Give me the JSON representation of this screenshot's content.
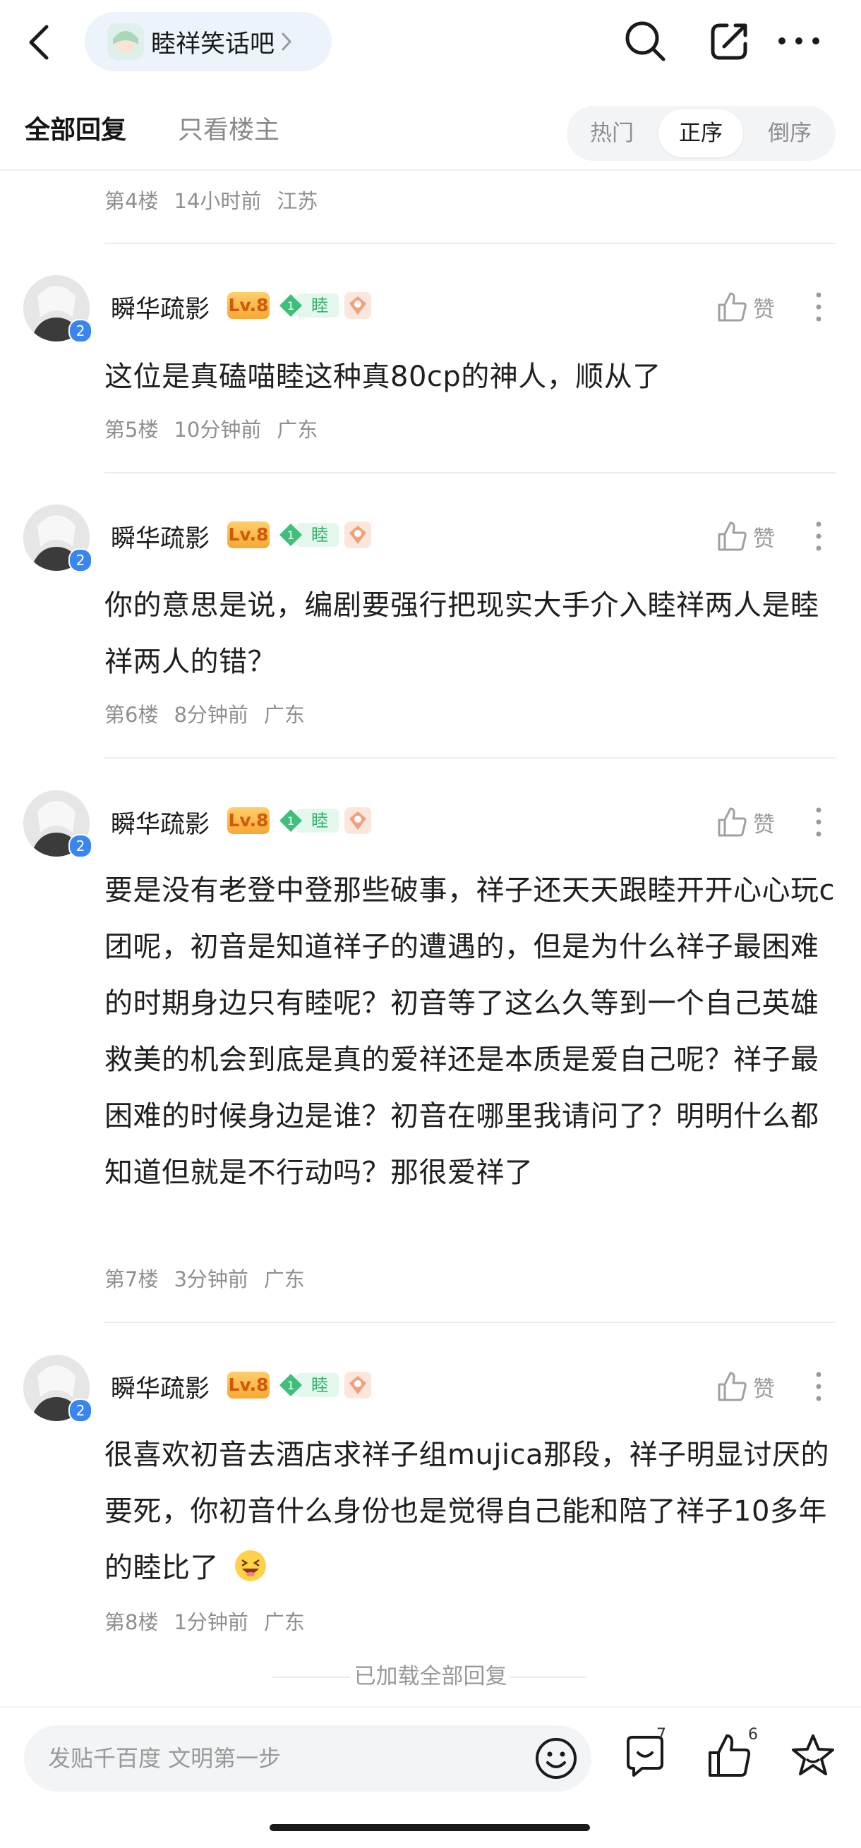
{
  "top_bar": {
    "forum_name": "睦祥笑话吧"
  },
  "tabs": {
    "all_replies": "全部回复",
    "only_op": "只看楼主",
    "sort": [
      "热门",
      "正序",
      "倒序"
    ],
    "active_sort": "正序"
  },
  "prev_post_meta": {
    "floor": "第4楼",
    "time": "14小时前",
    "location": "江苏"
  },
  "user": {
    "name": "瞬华疏影",
    "level": "Lv.8",
    "fan_level": "1",
    "fan_label": "睦",
    "avatar_badge": "2"
  },
  "like_label": "赞",
  "posts": [
    {
      "text": "这位是真磕喵睦这种真80cp的神人，顺从了",
      "floor": "第5楼",
      "time": "10分钟前",
      "location": "广东"
    },
    {
      "text": "你的意思是说，编剧要强行把现实大手介入睦祥两人是睦祥两人的错？",
      "floor": "第6楼",
      "time": "8分钟前",
      "location": "广东"
    },
    {
      "text": "要是没有老登中登那些破事，祥子还天天跟睦开开心心玩c团呢，初音是知道祥子的遭遇的，但是为什么祥子最困难的时期身边只有睦呢？初音等了这么久等到一个自己英雄救美的机会到底是真的爱祥还是本质是爱自己呢？祥子最困难的时候身边是谁？初音在哪里我请问了？明明什么都知道但就是不行动吗？那很爱祥了",
      "floor": "第7楼",
      "time": "3分钟前",
      "location": "广东"
    },
    {
      "text": "很喜欢初音去酒店求祥子组mujica那段，祥子明显讨厌的要死，你初音什么身份也是觉得自己能和陪了祥子10多年的睦比了",
      "floor": "第8楼",
      "time": "1分钟前",
      "location": "广东",
      "emoji": "grinning-squint-emoji"
    }
  ],
  "loaded_all": "已加载全部回复",
  "bottom_bar": {
    "input_placeholder": "发贴千百度 文明第一步",
    "comment_count": "7",
    "like_count": "6"
  },
  "colors": {
    "accent_blue": "#3a86f0",
    "level_orange": "#f6a935",
    "fan_green": "#35b26d"
  }
}
